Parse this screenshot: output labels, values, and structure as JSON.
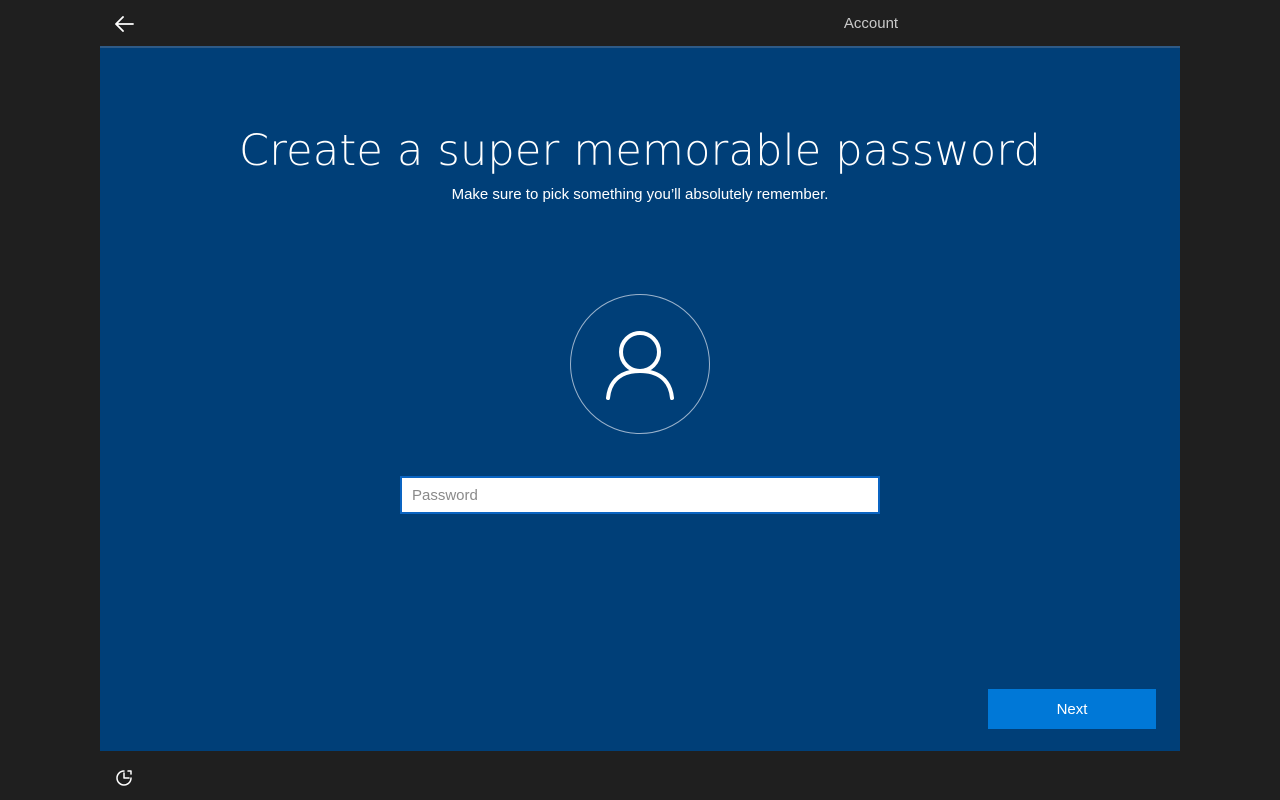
{
  "header": {
    "back_icon": "arrow-left-icon",
    "tab_label": "Account"
  },
  "main": {
    "title": "Create a super memorable password",
    "subtitle": "Make sure to pick something you’ll absolutely remember.",
    "avatar_icon": "user-icon",
    "password": {
      "value": "",
      "placeholder": "Password"
    },
    "next_label": "Next"
  },
  "footer": {
    "ease_of_access_icon": "ease-of-access-icon"
  },
  "colors": {
    "background": "#1f1f1f",
    "panel": "#003f78",
    "accent": "#0078d7",
    "input_border": "#0a64c2"
  }
}
